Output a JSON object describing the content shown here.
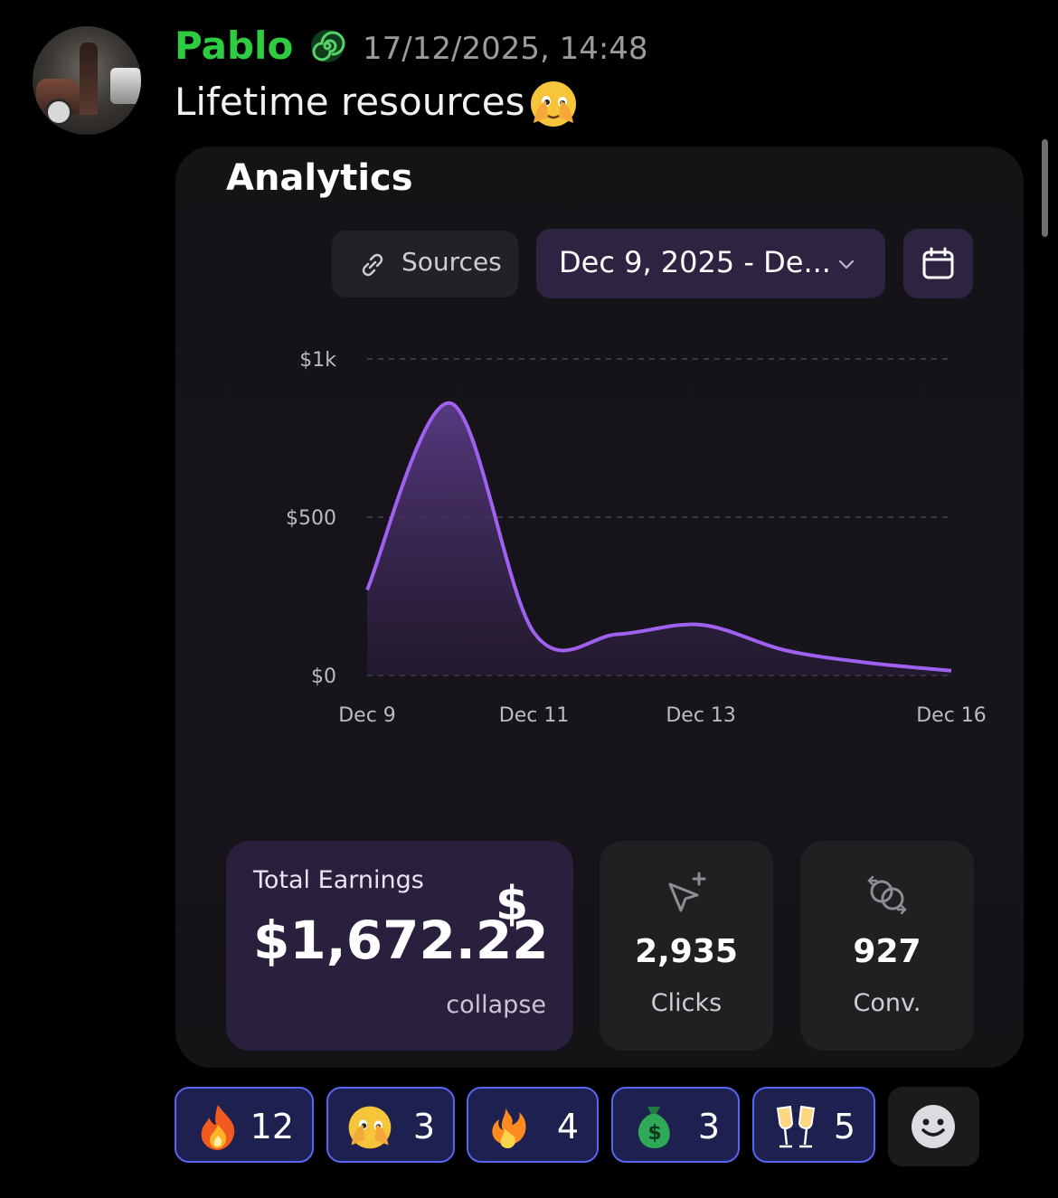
{
  "message": {
    "username": "Pablo",
    "username_color": "#2ecc40",
    "badge_icon": "spiral-badge-icon",
    "timestamp": "17/12/2025, 14:48",
    "text": "Lifetime resources",
    "text_emoji": "face-with-peeking-eye"
  },
  "card": {
    "title": "Analytics",
    "sources_label": "Sources",
    "date_range_label": "Dec 9, 2025 - De...",
    "calendar_icon": "calendar-icon",
    "accent_color": "#a061f0"
  },
  "chart_data": {
    "type": "area",
    "title": "",
    "xlabel": "",
    "ylabel": "",
    "ylim": [
      0,
      1000
    ],
    "y_ticks": [
      "$1k",
      "$500",
      "$0"
    ],
    "y_tick_values": [
      1000,
      500,
      0
    ],
    "x_ticks": [
      "Dec 9",
      "Dec 11",
      "Dec 13",
      "Dec 16"
    ],
    "x_tick_days": [
      9,
      11,
      13,
      16
    ],
    "grid": true,
    "series": [
      {
        "x": [
          9,
          10,
          11,
          12,
          13,
          14,
          15,
          16
        ],
        "values": [
          270,
          860,
          135,
          130,
          160,
          80,
          40,
          15
        ]
      }
    ]
  },
  "stats": {
    "earnings_title": "Total Earnings",
    "earnings_value": "$1,672.22",
    "earnings_symbol": "$",
    "collapse_label": "collapse",
    "clicks_value": "2,935",
    "clicks_label": "Clicks",
    "conv_value": "927",
    "conv_label": "Conv."
  },
  "reactions": [
    {
      "emoji": "fire",
      "count": "12"
    },
    {
      "emoji": "face-with-peeking-eye",
      "count": "3"
    },
    {
      "emoji": "flame-swirl",
      "count": "4"
    },
    {
      "emoji": "money-bag-green",
      "count": "3"
    },
    {
      "emoji": "clinking-glasses",
      "count": "5"
    }
  ],
  "reaction_border_color": "#5865f2",
  "reaction_bg_color": "#1e2150"
}
